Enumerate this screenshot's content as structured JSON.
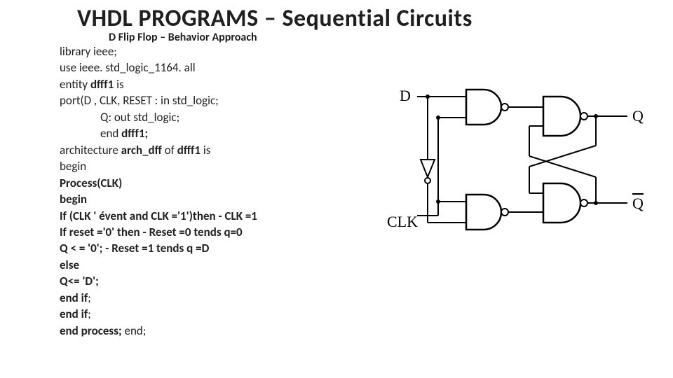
{
  "title": "VHDL PROGRAMS – Sequential  Circuits",
  "subtitle": "D Flip Flop – Behavior Approach",
  "code": {
    "l1": "library ieee;",
    "l2": "use ieee. std_logic_1164. all",
    "l3a": "entity  ",
    "l3b": "dfff1 ",
    "l3c": "is",
    "l4": "port(D , CLK, RESET : in std_logic;",
    "l5": "Q: out std_logic;",
    "l6a": "end ",
    "l6b": "dfff1;",
    "l7a": "architecture ",
    "l7b": "arch_dff ",
    "l7c": "of ",
    "l7d": "dfff1 ",
    "l7e": "is",
    "l8": "begin",
    "l9": "Process(CLK)",
    "l10": "begin",
    "l11": "If (CLK ' évent and CLK ='1')then  -  CLK =1",
    "l12": "If reset ='0' then   - Reset =0 tends q=0",
    "l13a": "Q < = '0';      ",
    "l13b": "- Reset =1 tends q =D",
    "l14": "else",
    "l15": "Q<= 'D';",
    "l16a": "end if",
    "l16b": ";",
    "l17a": "end if",
    "l17b": ";",
    "l18a": "end process; ",
    "l18b": "end;"
  },
  "diagram": {
    "label_d": "D",
    "label_clk": "CLK",
    "label_q": "Q",
    "label_qbar": "Q̄"
  }
}
